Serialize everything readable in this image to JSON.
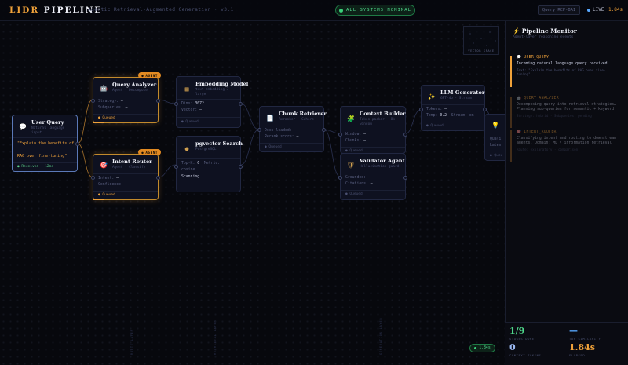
{
  "header": {
    "brand_main": "LIDR",
    "brand_rest": " PIPELINE",
    "subtitle": "Agentic Retrieval-Augmented Generation · v3.1",
    "status": "ALL SYSTEMS NOMINAL",
    "query_button": "Query RCP-BA1",
    "live": "LIVE",
    "elapsed": "1.84s"
  },
  "nodes": {
    "user_query": {
      "title": "User Query",
      "sub1": "Natural language",
      "sub2": "input",
      "quote1": "\"Explain the benefits of",
      "quote2": "RAG over fine-tuning\"",
      "foot": "Received · 12ms"
    },
    "query_analyzer": {
      "badge": "AGENT",
      "title": "Query Analyzer",
      "sub": "Agent · Decompose",
      "row1_label": "Strategy:",
      "row1_value": "—",
      "row2_label": "Subqueries:",
      "row2_value": "—",
      "foot": "Queued"
    },
    "intent_router": {
      "badge": "AGENT",
      "title": "Intent Router",
      "sub": "Agent · Classify",
      "row1_label": "Intent:",
      "row1_value": "—",
      "row2_label": "Confidence:",
      "row2_value": "—",
      "foot": "Queued"
    },
    "embedding_model": {
      "title": "Embedding Model",
      "sub1": "text-embedding-3-",
      "sub2": "large",
      "row1_label": "Dims:",
      "row1_value": "3072",
      "row2_label": "Vector:",
      "row2_value": "—",
      "foot": "Queued"
    },
    "pgvector_search": {
      "title": "pgvector Search",
      "sub": "PostgreSQL",
      "row1_label": "Top-K:",
      "row1_value": "6",
      "row1_extra": "Metric:",
      "row2_label": "cosine",
      "row3_label": "Scanning…"
    },
    "chunk_retriever": {
      "title": "Chunk Retriever",
      "sub": "Reranker · Cohere",
      "row1_label": "Docs loaded:",
      "row1_value": "—",
      "row2_label": "Rerank score:",
      "row2_value": "—",
      "foot": "Queued"
    },
    "context_builder": {
      "title": "Context Builder",
      "sub1": "Token packer · 8k",
      "sub2": "window",
      "row1_label": "Window:",
      "row1_value": "—",
      "row2_label": "Chunks:",
      "row2_value": "—",
      "foot": "Queued"
    },
    "validator_agent": {
      "title": "Validator Agent",
      "sub": "Hallucination guard",
      "row1_label": "Grounded:",
      "row1_value": "—",
      "row2_label": "Citations:",
      "row2_value": "—",
      "foot": "Queued"
    },
    "llm_generator": {
      "title": "LLM Generator",
      "sub": "GPT-4o · Stream",
      "row1_label": "Tokens:",
      "row1_value": "—",
      "row2_label": "Temp:",
      "row2_value": "0.2",
      "row2_extra": "Stream: on",
      "foot": "Queued"
    },
    "response": {
      "row1_label": "Quali",
      "row2_label": "Laten",
      "foot": "Queu"
    }
  },
  "vector_space": {
    "label": "VECTOR SPACE"
  },
  "panel": {
    "title": "Pipeline Monitor",
    "subtitle": "Agent-layer reasoning events",
    "events": [
      {
        "title": "USER_QUERY",
        "desc": "Incoming natural language query received.",
        "meta1": "Text: \"Explain the benefits of RAG over fine-",
        "meta2": "tuning\""
      },
      {
        "title": "QUERY_ANALYZER",
        "desc1": "Decomposing query into retrieval strategies…",
        "desc2": "Planning sub-queries for semantic + keyword",
        "meta": "Strategy: hybrid · Subqueries: pending"
      },
      {
        "title": "INTENT_ROUTER",
        "desc1": "Classifying intent and routing to downstream",
        "desc2": "agents. Domain: ML / information retrieval",
        "meta": "Route: explanatory · comparison"
      }
    ]
  },
  "stats": {
    "stages": "1/9",
    "stages_label": "STAGES DONE",
    "similarity": "—",
    "similarity_label": "TOP SIMILARITY",
    "tokens": "0",
    "tokens_label": "CONTEXT TOKENS",
    "elapsed": "1.84s",
    "elapsed_label": "ELAPSED"
  },
  "timer": "1.84s",
  "lane_labels": [
    "ROUTE LAYER",
    "RETRIEVAL LAYER",
    "GENERATION LAYER"
  ],
  "colors": {
    "accent": "#f0a23a",
    "success": "#4fd88b",
    "info": "#58a8ff",
    "done_border": "#5b79b8"
  },
  "icons": {
    "user_query": "speech-bubble-icon",
    "query_analyzer": "robot-icon",
    "intent_router": "target-icon",
    "embedding_model": "grid-icon",
    "pgvector_search": "search-dot-icon",
    "chunk_retriever": "document-icon",
    "context_builder": "puzzle-icon",
    "validator_agent": "shield-icon",
    "llm_generator": "sparkle-icon",
    "response": "lightbulb-icon"
  }
}
